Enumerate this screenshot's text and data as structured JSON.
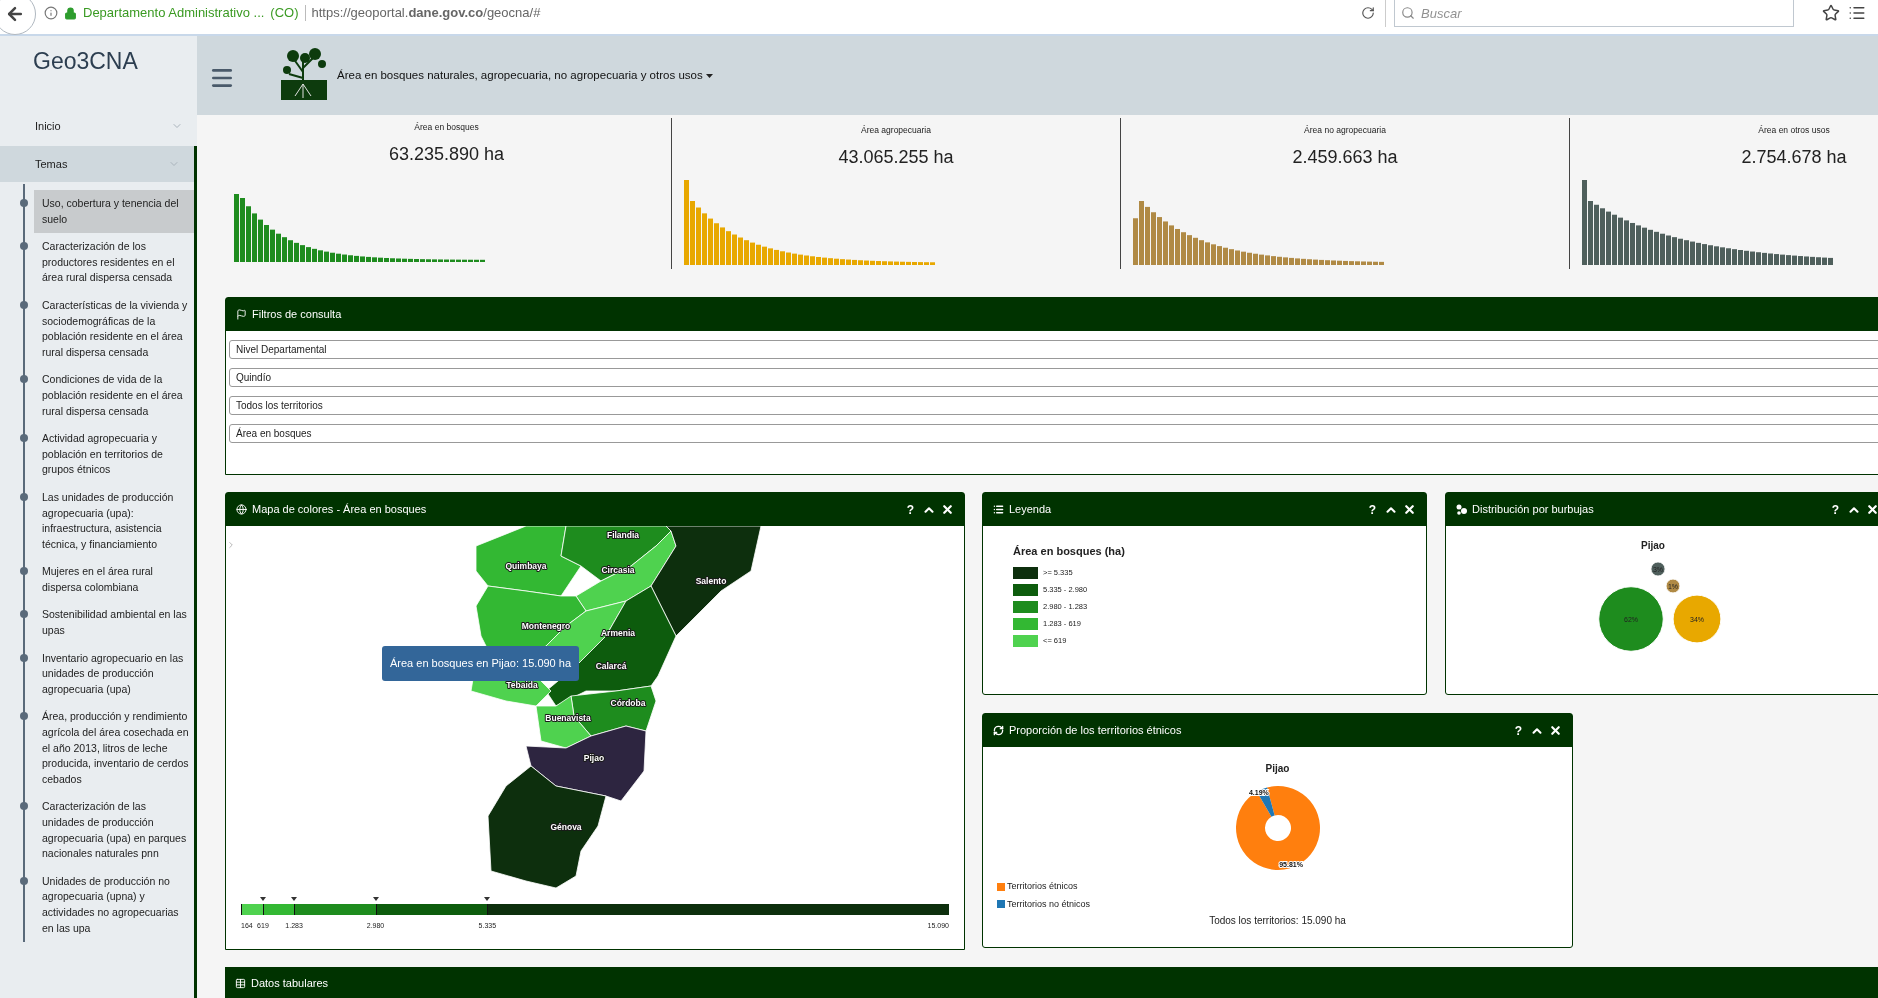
{
  "browser": {
    "site_name": "Departamento Administrativo ...",
    "country": "(CO)",
    "url": "https://geoportal.**dane.gov.co**/geocna/#",
    "search": {
      "placeholder": "Buscar"
    }
  },
  "sidebar": {
    "logo": "Geo3CNA",
    "items": [
      {
        "label": "Inicio",
        "selected": false
      },
      {
        "label": "Temas",
        "selected": true,
        "children": [
          {
            "label": "Uso, cobertura y tenencia del suelo",
            "selected": true
          },
          {
            "label": "Caracterización de los productores residentes en el área rural dispersa censada",
            "selected": false
          },
          {
            "label": "Características de la vivienda y sociodemográficas de la población residente en el área rural dispersa censada",
            "selected": false
          },
          {
            "label": "Condiciones de vida de la población residente en el área rural dispersa censada",
            "selected": false
          },
          {
            "label": "Actividad agropecuaria y población en territorios de grupos étnicos",
            "selected": false
          },
          {
            "label": "Las unidades de producción agropecuaria (upa): infraestructura, asistencia técnica, y financiamiento",
            "selected": false
          },
          {
            "label": "Mujeres en el área rural dispersa colombiana",
            "selected": false
          },
          {
            "label": "Sostenibilidad ambiental en las upas",
            "selected": false
          },
          {
            "label": "Inventario agropecuario en las unidades de producción agropecuaria (upa)",
            "selected": false
          },
          {
            "label": "Área, producción y rendimiento agrícola del área cosechada en el año 2013, litros de leche producida, inventario de cerdos cebados",
            "selected": false
          },
          {
            "label": "Caracterización de las unidades de producción agropecuaria (upa) en parques nacionales naturales  pnn",
            "selected": false
          },
          {
            "label": "Unidades de producción no agropecuaria (upna) y actividades no agropecuarias en las upa",
            "selected": false
          }
        ]
      }
    ]
  },
  "header": {
    "title": "Área en bosques naturales, agropecuaria, no agropecuaria y otros usos"
  },
  "stats": [
    {
      "label": "Área en bosques",
      "value": "63.235.890 ha",
      "color": "#1e8c1e"
    },
    {
      "label": "Área agropecuaria",
      "value": "43.065.255 ha",
      "color": "#e8a800"
    },
    {
      "label": "Área no agropecuaria",
      "value": "2.459.663 ha",
      "color": "#b08a45"
    },
    {
      "label": "Área en otros usos",
      "value": "2.754.678 ha",
      "color": "#4f5f5c"
    }
  ],
  "filters": {
    "title": "Filtros de consulta",
    "fields": [
      {
        "value": "Nivel Departamental"
      },
      {
        "value": "Quindío"
      },
      {
        "value": "Todos los territorios"
      },
      {
        "value": "Área en bosques"
      }
    ]
  },
  "map_panel": {
    "title": "Mapa de colores - Área en bosques",
    "help": "?",
    "tooltip": "Área en bosques en Pijao: 15.090 ha",
    "municipalities": [
      {
        "name": "Quimbaya",
        "color": "#33b833"
      },
      {
        "name": "Filandia",
        "color": "#1e8c1e"
      },
      {
        "name": "Circasia",
        "color": "#4fd24f"
      },
      {
        "name": "Salento",
        "color": "#0d2f0d"
      },
      {
        "name": "Montenegro",
        "color": "#33b833"
      },
      {
        "name": "Armenia",
        "color": "#4fd24f"
      },
      {
        "name": "Calarcá",
        "color": "#0d5c0d"
      },
      {
        "name": "Tebaida",
        "color": "#4fd24f"
      },
      {
        "name": "Córdoba",
        "color": "#1e8c1e"
      },
      {
        "name": "Buenavista",
        "color": "#4fd24f"
      },
      {
        "name": "Pijao",
        "color": "#2d2540"
      },
      {
        "name": "Génova",
        "color": "#0d2f0d"
      }
    ],
    "color_scale": {
      "segments": [
        {
          "color": "#4fd24f"
        },
        {
          "color": "#33b833"
        },
        {
          "color": "#1e8c1e"
        },
        {
          "color": "#0d5c0d"
        },
        {
          "color": "#0d2f0d"
        }
      ],
      "ticks": [
        "164",
        "619",
        "1.283",
        "2.980",
        "5.335",
        "15.090"
      ]
    }
  },
  "legend_panel": {
    "title": "Leyenda",
    "help": "?",
    "heading": "Área en bosques (ha)",
    "items": [
      {
        "label": ">= 5.335",
        "color": "#0d2f0d"
      },
      {
        "label": "5.335 - 2.980",
        "color": "#0d5c0d"
      },
      {
        "label": "2.980 - 1.283",
        "color": "#1e8c1e"
      },
      {
        "label": "1.283 - 619",
        "color": "#33b833"
      },
      {
        "label": "<= 619",
        "color": "#4fd24f"
      }
    ]
  },
  "bubble_panel": {
    "title": "Distribución por burbujas",
    "help": "?",
    "heading": "Pijao",
    "bubbles": [
      {
        "label": "62%",
        "color": "#1e8c1e"
      },
      {
        "label": "34%",
        "color": "#e8a800"
      },
      {
        "label": "3%",
        "color": "#4f5f5c"
      },
      {
        "label": "1%",
        "color": "#b08a45"
      }
    ]
  },
  "ethnic_panel": {
    "title": "Proporción de los territorios étnicos",
    "help": "?",
    "chart_data": {
      "type": "donut",
      "title": "Pijao",
      "categories": [
        "Territorios étnicos",
        "Territorios no étnicos"
      ],
      "values": [
        95.81,
        4.19
      ],
      "value_labels": [
        "95.81%",
        "4.19%"
      ]
    },
    "legend": [
      {
        "color": "#ff7f0e"
      },
      {
        "color": "#1f77b4"
      }
    ],
    "footer": "Todos los territorios: 15.090 ha"
  },
  "table_panel": {
    "title": "Datos tabulares"
  }
}
